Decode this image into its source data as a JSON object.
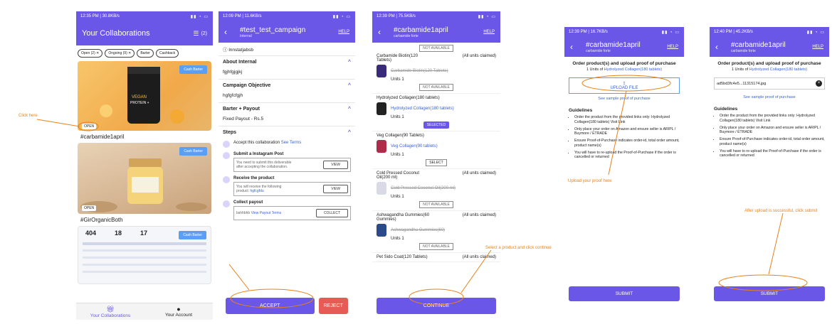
{
  "annotations": {
    "click_here": "Click here",
    "select_continue": "Select a product and click continue",
    "upload_proof": "Upload your proof here",
    "after_upload": "After upload is successful, click submit"
  },
  "screen1": {
    "status_time": "12:35 PM | 30.8KB/s",
    "title": "Your Collaborations",
    "filter_count": "(2)",
    "chips": [
      "Open (2)",
      "Ongoing (9)",
      "Barter",
      "Cashback"
    ],
    "cards": [
      {
        "tag": "Cash Barter",
        "status": "OPEN",
        "title": "#carbamide1april"
      },
      {
        "tag": "Cash Barter",
        "status": "OPEN",
        "title": "#GirOrganicBoth"
      },
      {
        "tag": "Cash Barter",
        "stats": [
          "404",
          "18",
          "17"
        ]
      }
    ],
    "nav": [
      {
        "label": "Your Collaborations"
      },
      {
        "label": "Your Account"
      }
    ],
    "colors": {
      "accent": "#6a57e8",
      "tag": "#5b9ff5"
    }
  },
  "screen2": {
    "status_time": "12:09 PM | 11.6KB/s",
    "title": "#test_test_campaign",
    "subtitle": "Internal",
    "help": "HELP",
    "top_text": "lnnstatjabsb",
    "sections": [
      {
        "head": "About Internal",
        "value": "fgjhfgjgjkj"
      },
      {
        "head": "Campaign Objective",
        "value": "hgfgfcfgjh"
      },
      {
        "head": "Barter + Payout",
        "value": "Fixed Payout - Rs.5"
      }
    ],
    "steps_head": "Steps",
    "steps": [
      {
        "text": "Accept this collaboration",
        "link": "See Terms"
      },
      {
        "heading": "Submit a Instagram Post",
        "box": "You need to submit this deliverable after accepting the collaboration.",
        "btn": "VIEW"
      },
      {
        "heading": "Receive the product",
        "box": "You will receive the following product:",
        "box_link": "hgfcgfdu",
        "btn": "VIEW"
      },
      {
        "heading": "Collect payout",
        "box": "bshhbhb",
        "box_link": "View Payout Terms",
        "btn": "COLLECT"
      }
    ],
    "accept": "ACCEPT",
    "reject": "REJECT"
  },
  "screen3": {
    "status_time": "12:39 PM | 75.5KB/s",
    "title": "#carbamide1april",
    "subtitle": "carbamide forte",
    "help": "HELP",
    "products": [
      {
        "name": "Carbamide Biotin(120 Tablets)",
        "claimed": "(All units claimed)",
        "item": "Carbamide Biotin(120 Tablets)",
        "units": "Units 1",
        "btn": "NOT AVAILABLE",
        "strike": true
      },
      {
        "name": "Hydrolyzed Collagen(180 tablets)",
        "item": "Hydrolyzed Collagen(180 tablets)",
        "units": "Units 1",
        "btn": "SELECTED",
        "strike": false
      },
      {
        "name": "Veg Collagen(90 Tablets)",
        "item": "Veg Collagen(90 tablets)",
        "units": "Units 1",
        "btn": "SELECT",
        "strike": false
      },
      {
        "name": "Cold Pressed Coconut Oil(200 ml)",
        "claimed": "(All units claimed)",
        "item": "Cold Pressed Coconut Oil(200 ml)",
        "units": "Units 1",
        "btn": "NOT AVAILABLE",
        "strike": true
      },
      {
        "name": "Ashwagandha Gummies(60 Gummies)",
        "claimed": "(All units claimed)",
        "item": "Ashwagandha Gummies(60)",
        "units": "Units 1",
        "btn": "NOT AVAILABLE",
        "strike": true
      },
      {
        "name": "Pet Sido Coat(120 Tablets)",
        "claimed": "(All units claimed)"
      }
    ],
    "top_btn": "NOT AVAILABLE",
    "continue": "CONTINUE"
  },
  "screen4": {
    "status_time": "12:39 PM | 16.7KB/s",
    "title": "#carbamide1april",
    "subtitle": "carbamide forte",
    "help": "HELP",
    "heading": "Order product(s) and upload proof of purchase",
    "units_prefix": "1 Units of",
    "units_link": "Hydrolyzed Collagen(180 tablets)",
    "upload_btn": "UPLOAD FILE",
    "sample_link": "See sample proof of purchase",
    "guidelines_head": "Guidelines",
    "guidelines": [
      "Order the product from the provided links only: Hydrolyzed Collagen(180 tablets) Visit Link",
      "Only place your order on Amazon and ensure seller is ARIPL / Buymore / ETRADE",
      "Ensure Proof-of-Purchase indicates order-id, total order amount, product name(s)",
      "You will have to re-upload the Proof-of-Purchase if the order is cancelled or returned"
    ],
    "submit": "SUBMIT"
  },
  "screen5": {
    "status_time": "12:40 PM | 45.2KB/s",
    "title": "#carbamide1april",
    "subtitle": "carbamide forte",
    "help": "HELP",
    "heading": "Order product(s) and upload proof of purchase",
    "units_prefix": "1 Units of",
    "units_link": "Hydrolyzed Collagen(180 tablets)",
    "file_name": "ad5bd3fc4e5...11315174.jpg",
    "sample_link": "See sample proof of purchase",
    "guidelines_head": "Guidelines",
    "guidelines": [
      "Order the product from the provided links only: Hydrolyzed Collagen(180 tablets) Visit Link",
      "Only place your order on Amazon and ensure seller is ARIPL / Buymore / ETRADE",
      "Ensure Proof-of-Purchase indicates order-id, total order amount, product name(s)",
      "You will have to re-upload the Proof-of-Purchase if the order is cancelled or returned"
    ],
    "submit": "SUBMIT"
  }
}
